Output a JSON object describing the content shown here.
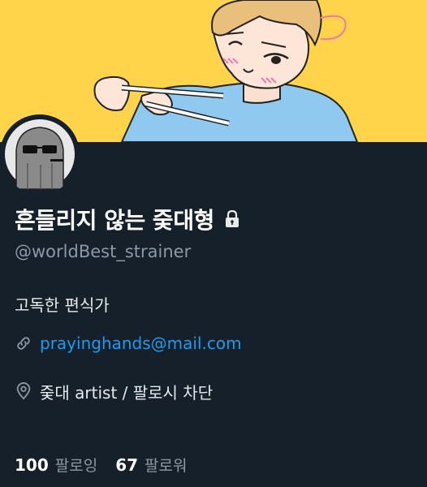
{
  "profile": {
    "display_name": "흔들리지 않는 줒대형",
    "handle": "@worldBest_strainer",
    "bio": "고독한 편식가",
    "link": "prayinghands@mail.com",
    "location": "줒대 artist / 팔로시 차단",
    "protected_icon": "lock-icon"
  },
  "stats": {
    "following_count": "100",
    "following_label": "팔로잉",
    "followers_count": "67",
    "followers_label": "팔로워"
  },
  "colors": {
    "background": "#15202b",
    "banner": "#ffd44a",
    "link": "#1d9bf0",
    "muted": "#8b98a5"
  },
  "icons": {
    "link": "link-icon",
    "location": "location-pin-icon"
  }
}
